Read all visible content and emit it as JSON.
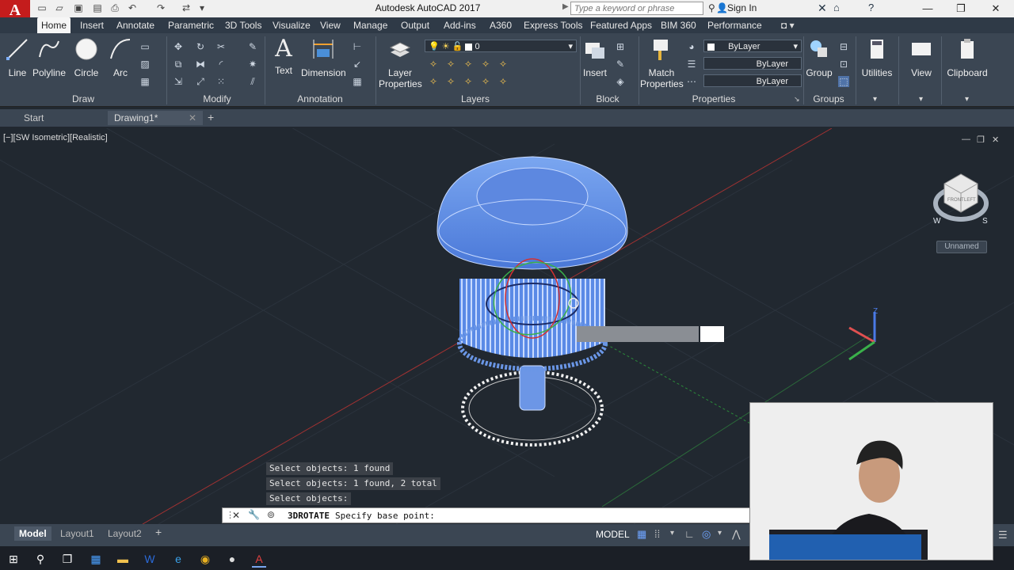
{
  "app": {
    "logo": "A",
    "title": "Autodesk AutoCAD 2017",
    "search_placeholder": "Type a keyword or phrase",
    "sign_in": "Sign In"
  },
  "ribbon_tabs": [
    "Home",
    "Insert",
    "Annotate",
    "Parametric",
    "3D Tools",
    "Visualize",
    "View",
    "Manage",
    "Output",
    "Add-ins",
    "A360",
    "Express Tools",
    "Featured Apps",
    "BIM 360",
    "Performance"
  ],
  "ribbon": {
    "draw": {
      "line": "Line",
      "polyline": "Polyline",
      "circle": "Circle",
      "arc": "Arc",
      "label": "Draw"
    },
    "modify": {
      "label": "Modify"
    },
    "annotation": {
      "text": "Text",
      "dimension": "Dimension",
      "label": "Annotation"
    },
    "layers": {
      "layer_properties_1": "Layer",
      "layer_properties_2": "Properties",
      "layer_value": "0",
      "label": "Layers"
    },
    "block": {
      "insert": "Insert",
      "label": "Block"
    },
    "properties": {
      "match_1": "Match",
      "match_2": "Properties",
      "color": "ByLayer",
      "linetype": "ByLayer",
      "lineweight": "ByLayer",
      "label": "Properties"
    },
    "groups": {
      "group": "Group",
      "label": "Groups"
    },
    "utilities": {
      "label": "Utilities"
    },
    "view": {
      "label": "View"
    },
    "clipboard": {
      "label": "Clipboard"
    }
  },
  "file_tabs": {
    "start": "Start",
    "drawing": "Drawing1*"
  },
  "viewport": {
    "label": "[−][SW Isometric][Realistic]",
    "viewcube_label": "Unnamed",
    "cube_front": "FRONT",
    "cube_left": "LEFT",
    "compass_w": "W",
    "compass_s": "S",
    "ucs_z": "Z"
  },
  "command": {
    "history": [
      "Select objects: 1 found",
      "Select objects: 1 found, 2 total",
      "Select objects:"
    ],
    "current_cmd": "3DROTATE",
    "prompt": "Specify base point:"
  },
  "layout_tabs": [
    "Model",
    "Layout1",
    "Layout2"
  ],
  "status": {
    "model": "MODEL"
  },
  "colors": {
    "accent": "#c41c1c",
    "object": "#6a96e6",
    "titlebar": "#f0f0f0",
    "ribbon": "#3b4653",
    "viewport": "#212830"
  }
}
